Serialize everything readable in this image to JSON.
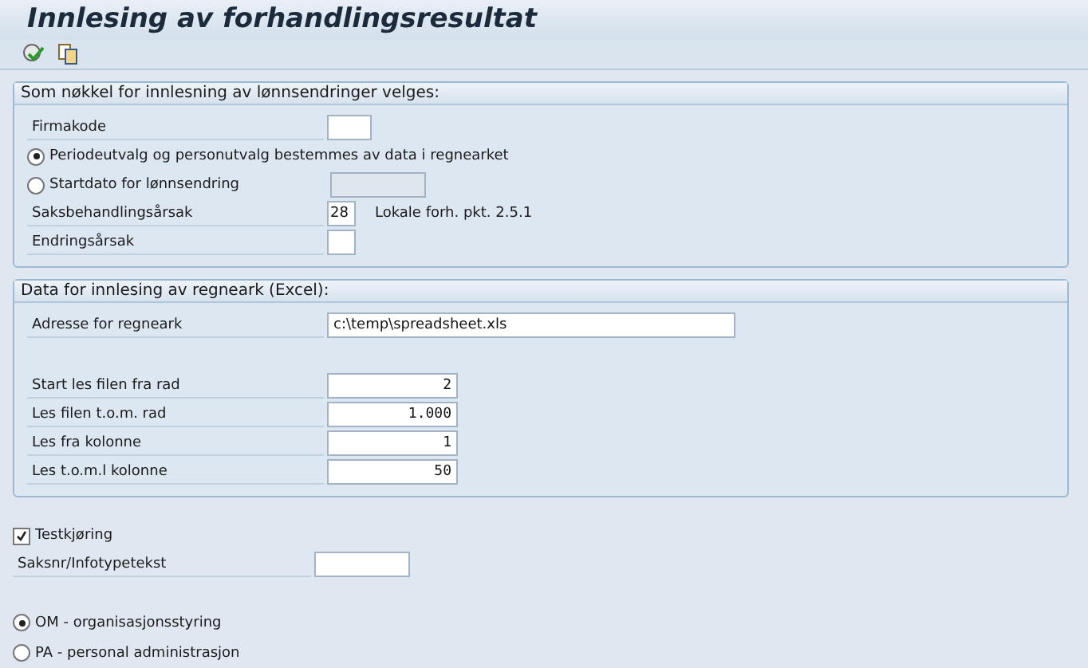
{
  "title": "Innlesing av forhandlingsresultat",
  "toolbar": [
    {
      "kind": "execute"
    },
    {
      "kind": "variant"
    }
  ],
  "groups": [
    {
      "title": "Som nøkkel for innlesning av lønnsendringer velges:",
      "rows": [
        {
          "kind": "field",
          "label": "Firmakode",
          "field": {
            "kind": "code"
          }
        },
        {
          "kind": "radio",
          "label": "Periodeutvalg og personutvalg bestemmes av data i regnearket",
          "selected": true
        },
        {
          "kind": "radio",
          "label": "Startdato for lønnsendring",
          "selected": false,
          "field": {
            "kind": "date"
          }
        },
        {
          "kind": "field",
          "label": "Saksbehandlingsårsak",
          "field": {
            "kind": "char",
            "value": "28"
          },
          "note": "Lokale forh. pkt. 2.5.1"
        },
        {
          "kind": "field",
          "label": "Endringsårsak",
          "field": {
            "kind": "char"
          }
        }
      ]
    },
    {
      "title": "Data for innlesing av regneark (Excel):",
      "rows": [
        {
          "kind": "field",
          "label": "Adresse for regneark",
          "field": {
            "kind": "path",
            "value": "c:\\temp\\spreadsheet.xls"
          }
        },
        {
          "kind": "gap"
        },
        {
          "kind": "field",
          "label": "Start les filen fra rad",
          "field": {
            "kind": "number",
            "value": "2"
          }
        },
        {
          "kind": "field",
          "label": "Les filen t.o.m. rad",
          "field": {
            "kind": "number",
            "value": "1.000"
          }
        },
        {
          "kind": "field",
          "label": "Les fra kolonne",
          "field": {
            "kind": "number",
            "value": "1"
          }
        },
        {
          "kind": "field",
          "label": "Les t.o.m.l kolonne",
          "field": {
            "kind": "number",
            "value": "50"
          }
        }
      ]
    }
  ],
  "test_run": {
    "label": "Testkjøring",
    "checked": true
  },
  "case_text": {
    "label": "Saksnr/Infotypetekst"
  },
  "modes": [
    {
      "label": "OM - organisasjonsstyring",
      "selected": true
    },
    {
      "label": "PA - personal administrasjon",
      "selected": false
    }
  ]
}
